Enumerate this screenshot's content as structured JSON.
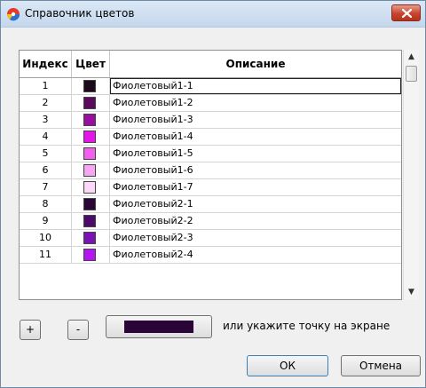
{
  "window": {
    "title": "Справочник цветов",
    "icon": "color-wheel-icon",
    "close_icon": "close-icon"
  },
  "table": {
    "columns": [
      "Индекс",
      "Цвет",
      "Описание"
    ],
    "rows": [
      {
        "index": "1",
        "color": "#1b0a1c",
        "description": "Фиолетовый1-1"
      },
      {
        "index": "2",
        "color": "#5a0a5c",
        "description": "Фиолетовый1-2"
      },
      {
        "index": "3",
        "color": "#9a0ea0",
        "description": "Фиолетовый1-3"
      },
      {
        "index": "4",
        "color": "#e614e8",
        "description": "Фиолетовый1-4"
      },
      {
        "index": "5",
        "color": "#f25ef0",
        "description": "Фиолетовый1-5"
      },
      {
        "index": "6",
        "color": "#f7a6f4",
        "description": "Фиолетовый1-6"
      },
      {
        "index": "7",
        "color": "#fbd8fa",
        "description": "Фиолетовый1-7"
      },
      {
        "index": "8",
        "color": "#2a0538",
        "description": "Фиолетовый2-1"
      },
      {
        "index": "9",
        "color": "#4e0a6a",
        "description": "Фиолетовый2-2"
      },
      {
        "index": "10",
        "color": "#7a12b4",
        "description": "Фиолетовый2-3"
      },
      {
        "index": "11",
        "color": "#b515f2",
        "description": "Фиолетовый2-4"
      }
    ],
    "active_row": 1
  },
  "controls": {
    "add_label": "+",
    "remove_label": "-",
    "picked_color": "#2a0538",
    "hint": "или  укажите точку на экране",
    "ok_label": "ОК",
    "cancel_label": "Отмена"
  },
  "scrollbar": {
    "up_icon": "scroll-up-arrow-icon",
    "down_icon": "scroll-down-arrow-icon"
  }
}
